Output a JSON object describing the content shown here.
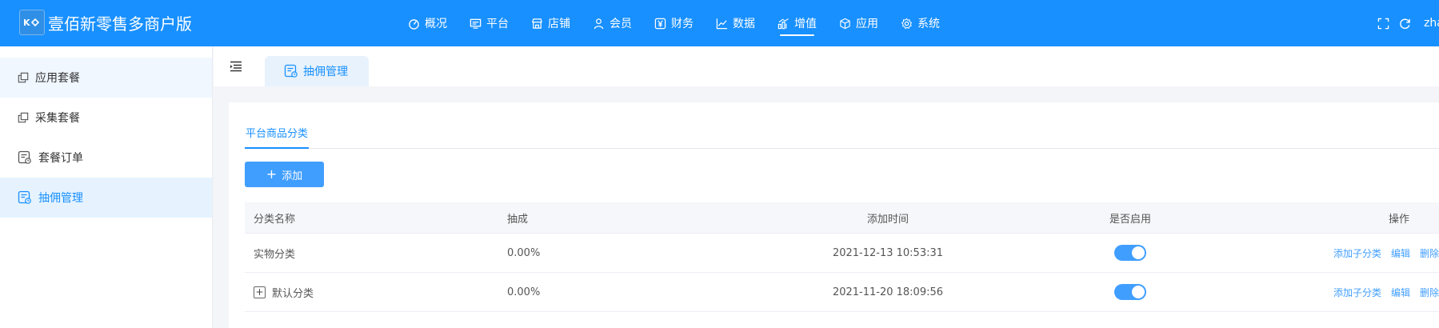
{
  "app": {
    "title": "壹佰新零售多商户版",
    "user": "zha"
  },
  "topnav": [
    {
      "label": "概况",
      "icon": "dashboard-icon"
    },
    {
      "label": "平台",
      "icon": "platform-icon"
    },
    {
      "label": "店铺",
      "icon": "store-icon"
    },
    {
      "label": "会员",
      "icon": "member-icon"
    },
    {
      "label": "财务",
      "icon": "finance-icon"
    },
    {
      "label": "数据",
      "icon": "data-chart-icon"
    },
    {
      "label": "增值",
      "icon": "value-added-icon",
      "active": true
    },
    {
      "label": "应用",
      "icon": "app-cube-icon"
    },
    {
      "label": "系统",
      "icon": "settings-icon"
    }
  ],
  "sidebar": {
    "items": [
      {
        "label": "应用套餐",
        "icon": "copy-icon"
      },
      {
        "label": "采集套餐",
        "icon": "copy-icon"
      },
      {
        "label": "套餐订单",
        "icon": "order-form-icon"
      },
      {
        "label": "抽佣管理",
        "icon": "commission-form-icon",
        "active": true
      }
    ]
  },
  "tabstrip": {
    "active_tab": "抽佣管理"
  },
  "main": {
    "subtab": "平台商品分类",
    "add_button": "添加",
    "table": {
      "headers": {
        "name": "分类名称",
        "rate": "抽成",
        "time": "添加时间",
        "enabled": "是否启用",
        "ops": "操作"
      },
      "rows": [
        {
          "name": "实物分类",
          "rate": "0.00%",
          "time": "2021-12-13 10:53:31",
          "enabled": true,
          "expandable": false
        },
        {
          "name": "默认分类",
          "rate": "0.00%",
          "time": "2021-11-20 18:09:56",
          "enabled": true,
          "expandable": true
        }
      ],
      "actions": {
        "add_child": "添加子分类",
        "edit": "编辑",
        "delete": "删除"
      }
    }
  },
  "colors": {
    "brand_blue": "#1890ff",
    "button_blue": "#409eff",
    "sidebar_active_bg": "#e6f3ff"
  }
}
